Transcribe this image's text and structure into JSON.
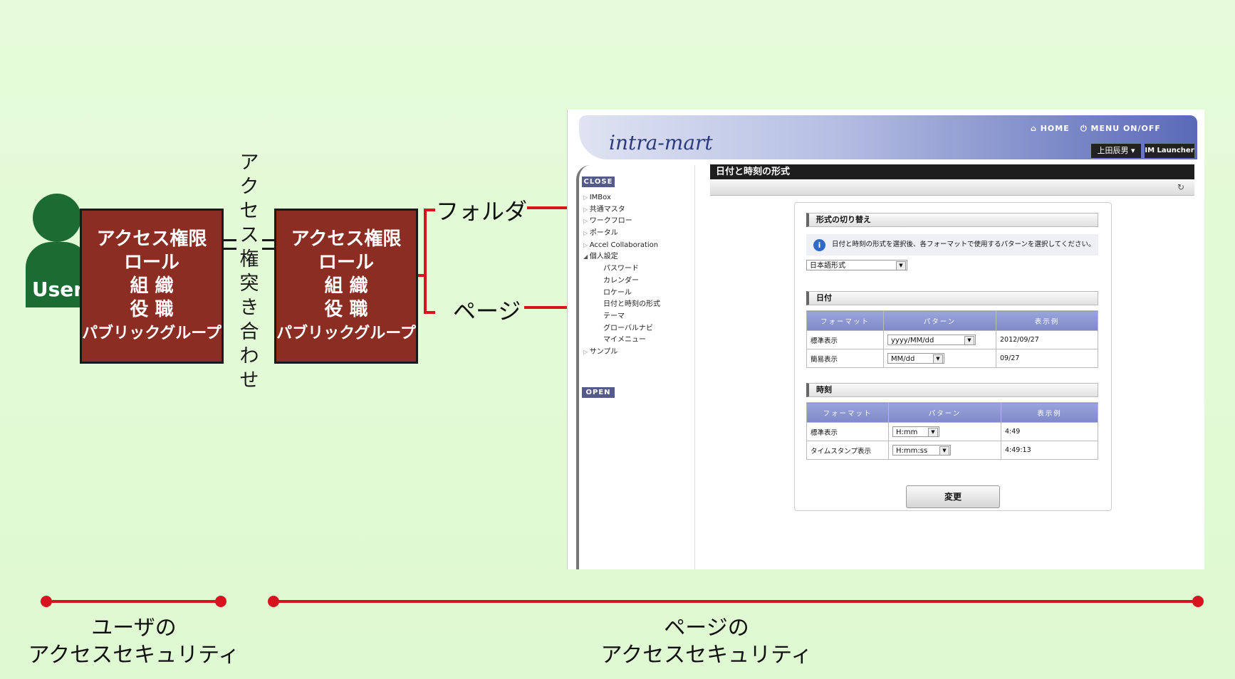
{
  "user": {
    "label": "User"
  },
  "box_left": {
    "lines": [
      "アクセス権限",
      "ロール",
      "組 織",
      "役 職",
      "パブリックグループ"
    ]
  },
  "box_right": {
    "lines": [
      "アクセス権限",
      "ロール",
      "組 織",
      "役 職",
      "パブリックグループ"
    ]
  },
  "match_label": [
    "ア",
    "ク",
    "セ",
    "ス",
    "権",
    "突",
    "き",
    "合",
    "わ",
    "せ"
  ],
  "targets": {
    "folder": "フォルダ",
    "page": "ページ"
  },
  "captions": {
    "user": [
      "ユーザの",
      "アクセスセキュリティ"
    ],
    "page": [
      "ページの",
      "アクセスセキュリティ"
    ]
  },
  "colors": {
    "accent_red": "#d7141e",
    "box_red": "#8c2d24",
    "user_green": "#1b6b33"
  },
  "screenshot": {
    "logo": "intra-mart",
    "nav_home": "HOME",
    "nav_menu": "MENU ON/OFF",
    "user_name": "上田辰男",
    "im_launcher": "IM Launcher",
    "close_label": "CLOSE",
    "open_label": "OPEN",
    "menu": [
      {
        "label": "IMBox",
        "kind": "parent"
      },
      {
        "label": "共通マスタ",
        "kind": "parent"
      },
      {
        "label": "ワークフロー",
        "kind": "parent"
      },
      {
        "label": "ポータル",
        "kind": "parent"
      },
      {
        "label": "Accel Collaboration",
        "kind": "parent"
      },
      {
        "label": "個人設定",
        "kind": "open"
      },
      {
        "label": "パスワード",
        "kind": "child"
      },
      {
        "label": "カレンダー",
        "kind": "child"
      },
      {
        "label": "ロケール",
        "kind": "child"
      },
      {
        "label": "日付と時刻の形式",
        "kind": "child"
      },
      {
        "label": "テーマ",
        "kind": "child"
      },
      {
        "label": "グローバルナビ",
        "kind": "child"
      },
      {
        "label": "マイメニュー",
        "kind": "child"
      },
      {
        "label": "サンプル",
        "kind": "parent"
      }
    ],
    "page_title": "日付と時刻の形式",
    "refresh_icon": "refresh-icon",
    "switch_section": "形式の切り替え",
    "info_text": "日付と時刻の形式を選択後、各フォーマットで使用するパターンを選択してください。",
    "format_select": "日本語形式",
    "date_section": "日付",
    "time_section": "時刻",
    "col_format": "フォーマット",
    "col_pattern": "パターン",
    "col_example": "表示例",
    "date_rows": [
      {
        "format": "標準表示",
        "pattern": "yyyy/MM/dd",
        "example": "2012/09/27"
      },
      {
        "format": "簡易表示",
        "pattern": "MM/dd",
        "example": "09/27"
      }
    ],
    "time_rows": [
      {
        "format": "標準表示",
        "pattern": "H:mm",
        "example": "4:49"
      },
      {
        "format": "タイムスタンプ表示",
        "pattern": "H:mm:ss",
        "example": "4:49:13"
      }
    ],
    "submit_label": "変更"
  }
}
